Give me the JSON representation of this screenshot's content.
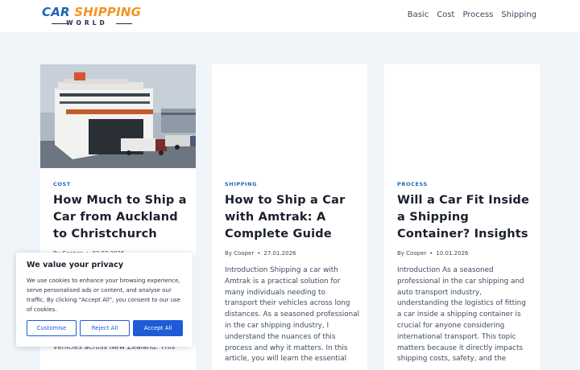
{
  "site": {
    "logo_main_1": "CAR ",
    "logo_main_2": "SHIPPING",
    "logo_sub": "WORLD",
    "colors": {
      "brand_blue": "#1e66b8",
      "brand_orange": "#f39423",
      "accent_button": "#1e5bd8"
    }
  },
  "nav": {
    "items": [
      {
        "label": "Basic"
      },
      {
        "label": "Cost"
      },
      {
        "label": "Process"
      },
      {
        "label": "Shipping"
      }
    ]
  },
  "posts": [
    {
      "category": "COST",
      "title": "How Much to Ship a Car from Auckland to Christchurch",
      "author": "By Cooper",
      "date": "02.02.2026",
      "excerpt": "complexities involved in transporting vehicles across New Zealand. This",
      "image": "ferry-loading-trucks-photo"
    },
    {
      "category": "SHIPPING",
      "title": "How to Ship a Car with Amtrak: A Complete Guide",
      "author": "By Cooper",
      "date": "27.01.2026",
      "excerpt": "Introduction Shipping a car with Amtrak is a practical solution for many individuals needing to transport their vehicles across long distances. As a seasoned professional in the car shipping industry, I understand the nuances of this process and why it matters. In this article, you will learn the essential"
    },
    {
      "category": "PROCESS",
      "title": "Will a Car Fit Inside a Shipping Container? Insights",
      "author": "By Cooper",
      "date": "10.01.2026",
      "excerpt": "Introduction As a seasoned professional in the car shipping and auto transport industry, understanding the logistics of fitting a car inside a shipping container is crucial for anyone considering international transport. This topic matters because it directly impacts shipping costs, safety, and the"
    }
  ],
  "cookie": {
    "title": "We value your privacy",
    "text": "We use cookies to enhance your browsing experience, serve personalised ads or content, and analyse our traffic. By clicking \"Accept All\", you consent to our use of cookies.",
    "customise": "Customise",
    "reject": "Reject All",
    "accept": "Accept All"
  }
}
